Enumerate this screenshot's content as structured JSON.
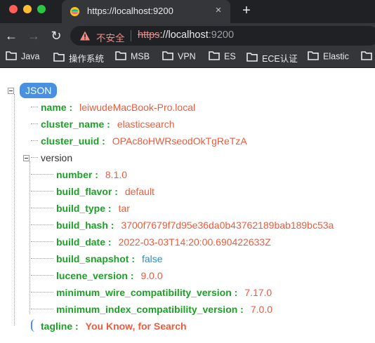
{
  "window": {
    "traffic_lights": [
      "close",
      "minimize",
      "zoom"
    ]
  },
  "tab": {
    "title": "https://localhost:9200",
    "close": "×",
    "new_tab": "+"
  },
  "toolbar": {
    "back": "←",
    "forward": "→",
    "reload": "↻",
    "insecure_label": "不安全",
    "url_scheme": "https",
    "url_host": "://localhost",
    "url_port": ":9200"
  },
  "bookmarks": [
    "Java",
    "操作系统",
    "MSB",
    "VPN",
    "ES",
    "ECE认证",
    "Elastic"
  ],
  "json_root": "JSON",
  "json": {
    "name": {
      "key": "name :",
      "value": "leiwudeMacBook-Pro.local"
    },
    "cluster_name": {
      "key": "cluster_name :",
      "value": "elasticsearch"
    },
    "cluster_uuid": {
      "key": "cluster_uuid :",
      "value": "OPAc8oHWRseodOkTgReTzA"
    },
    "version_label": "version",
    "version": {
      "number": {
        "key": "number :",
        "value": "8.1.0"
      },
      "build_flavor": {
        "key": "build_flavor :",
        "value": "default"
      },
      "build_type": {
        "key": "build_type :",
        "value": "tar"
      },
      "build_hash": {
        "key": "build_hash :",
        "value": "3700f7679f7d95e36da0b43762189bab189bc53a"
      },
      "build_date": {
        "key": "build_date :",
        "value": "2022-03-03T14:20:00.690422633Z"
      },
      "build_snapshot": {
        "key": "build_snapshot :",
        "value": "false"
      },
      "lucene_version": {
        "key": "lucene_version :",
        "value": "9.0.0"
      },
      "minimum_wire_compatibility_version": {
        "key": "minimum_wire_compatibility_version :",
        "value": "7.17.0"
      },
      "minimum_index_compatibility_version": {
        "key": "minimum_index_compatibility_version :",
        "value": "7.0.0"
      }
    },
    "tagline": {
      "key": "tagline :",
      "value": "You Know, for Search"
    }
  },
  "colors": {
    "key": "#19a223",
    "string": "#f05a3a",
    "boolean": "#1a93d6",
    "badge": "#4a90e2",
    "tab_bg": "#35363a",
    "frame_bg": "#202124",
    "insecure": "#f28b82"
  }
}
